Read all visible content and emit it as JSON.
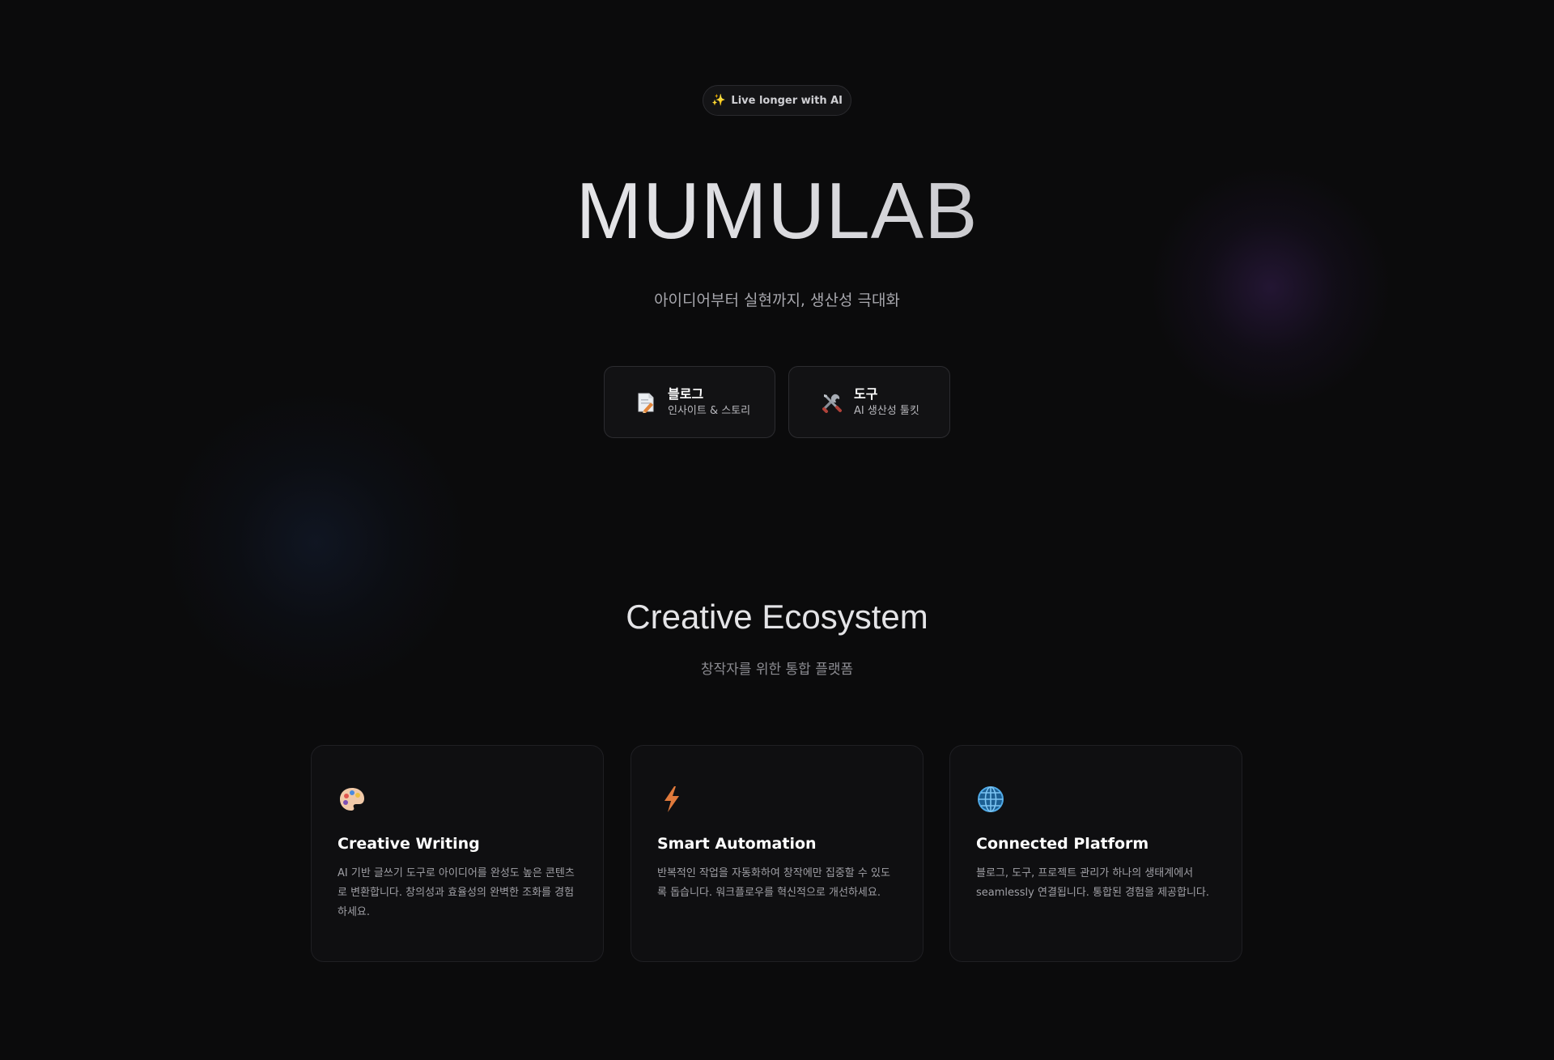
{
  "badge": {
    "icon": "sparkle-icon",
    "label": "Live longer with AI"
  },
  "hero": {
    "brand": "MUMULAB",
    "tagline": "아이디어부터 실현까지, 생산성 극대화",
    "buttons": [
      {
        "icon": "document-icon",
        "title": "블로그",
        "subtitle": "인사이트 & 스토리"
      },
      {
        "icon": "tools-icon",
        "title": "도구",
        "subtitle": "AI 생산성 툴킷"
      }
    ]
  },
  "ecosystem": {
    "title": "Creative Ecosystem",
    "subtitle": "창작자를 위한 통합 플랫폼",
    "cards": [
      {
        "icon": "palette-icon",
        "title": "Creative Writing",
        "description": "AI 기반 글쓰기 도구로 아이디어를 완성도 높은 콘텐츠로 변환합니다. 창의성과 효율성의 완벽한 조화를 경험하세요."
      },
      {
        "icon": "lightning-icon",
        "title": "Smart Automation",
        "description": "반복적인 작업을 자동화하여 창작에만 집중할 수 있도록 돕습니다. 워크플로우를 혁신적으로 개선하세요."
      },
      {
        "icon": "globe-icon",
        "title": "Connected Platform",
        "description": "블로그, 도구, 프로젝트 관리가 하나의 생태계에서 seamlessly 연결됩니다. 통합된 경험을 제공합니다."
      }
    ]
  },
  "colors": {
    "background": "#0b0b0c",
    "card_background": "#0f0f11",
    "border": "#2a2a2e",
    "accent_glow_purple": "#442468",
    "accent_glow_blue": "#162440"
  }
}
